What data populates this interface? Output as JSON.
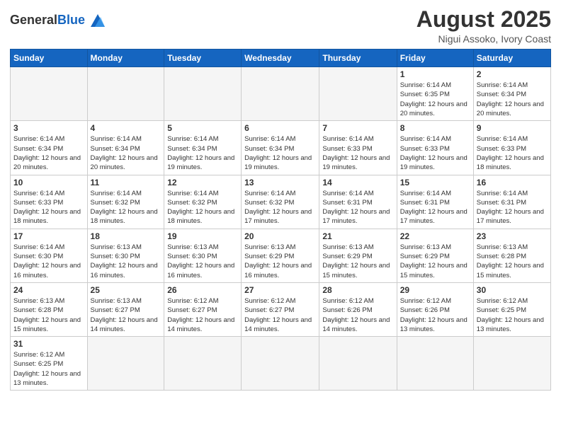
{
  "header": {
    "logo_general": "General",
    "logo_blue": "Blue",
    "month_title": "August 2025",
    "subtitle": "Nigui Assoko, Ivory Coast"
  },
  "weekdays": [
    "Sunday",
    "Monday",
    "Tuesday",
    "Wednesday",
    "Thursday",
    "Friday",
    "Saturday"
  ],
  "weeks": [
    [
      {
        "day": "",
        "info": ""
      },
      {
        "day": "",
        "info": ""
      },
      {
        "day": "",
        "info": ""
      },
      {
        "day": "",
        "info": ""
      },
      {
        "day": "",
        "info": ""
      },
      {
        "day": "1",
        "info": "Sunrise: 6:14 AM\nSunset: 6:35 PM\nDaylight: 12 hours\nand 20 minutes."
      },
      {
        "day": "2",
        "info": "Sunrise: 6:14 AM\nSunset: 6:34 PM\nDaylight: 12 hours\nand 20 minutes."
      }
    ],
    [
      {
        "day": "3",
        "info": "Sunrise: 6:14 AM\nSunset: 6:34 PM\nDaylight: 12 hours\nand 20 minutes."
      },
      {
        "day": "4",
        "info": "Sunrise: 6:14 AM\nSunset: 6:34 PM\nDaylight: 12 hours\nand 20 minutes."
      },
      {
        "day": "5",
        "info": "Sunrise: 6:14 AM\nSunset: 6:34 PM\nDaylight: 12 hours\nand 19 minutes."
      },
      {
        "day": "6",
        "info": "Sunrise: 6:14 AM\nSunset: 6:34 PM\nDaylight: 12 hours\nand 19 minutes."
      },
      {
        "day": "7",
        "info": "Sunrise: 6:14 AM\nSunset: 6:33 PM\nDaylight: 12 hours\nand 19 minutes."
      },
      {
        "day": "8",
        "info": "Sunrise: 6:14 AM\nSunset: 6:33 PM\nDaylight: 12 hours\nand 19 minutes."
      },
      {
        "day": "9",
        "info": "Sunrise: 6:14 AM\nSunset: 6:33 PM\nDaylight: 12 hours\nand 18 minutes."
      }
    ],
    [
      {
        "day": "10",
        "info": "Sunrise: 6:14 AM\nSunset: 6:33 PM\nDaylight: 12 hours\nand 18 minutes."
      },
      {
        "day": "11",
        "info": "Sunrise: 6:14 AM\nSunset: 6:32 PM\nDaylight: 12 hours\nand 18 minutes."
      },
      {
        "day": "12",
        "info": "Sunrise: 6:14 AM\nSunset: 6:32 PM\nDaylight: 12 hours\nand 18 minutes."
      },
      {
        "day": "13",
        "info": "Sunrise: 6:14 AM\nSunset: 6:32 PM\nDaylight: 12 hours\nand 17 minutes."
      },
      {
        "day": "14",
        "info": "Sunrise: 6:14 AM\nSunset: 6:31 PM\nDaylight: 12 hours\nand 17 minutes."
      },
      {
        "day": "15",
        "info": "Sunrise: 6:14 AM\nSunset: 6:31 PM\nDaylight: 12 hours\nand 17 minutes."
      },
      {
        "day": "16",
        "info": "Sunrise: 6:14 AM\nSunset: 6:31 PM\nDaylight: 12 hours\nand 17 minutes."
      }
    ],
    [
      {
        "day": "17",
        "info": "Sunrise: 6:14 AM\nSunset: 6:30 PM\nDaylight: 12 hours\nand 16 minutes."
      },
      {
        "day": "18",
        "info": "Sunrise: 6:13 AM\nSunset: 6:30 PM\nDaylight: 12 hours\nand 16 minutes."
      },
      {
        "day": "19",
        "info": "Sunrise: 6:13 AM\nSunset: 6:30 PM\nDaylight: 12 hours\nand 16 minutes."
      },
      {
        "day": "20",
        "info": "Sunrise: 6:13 AM\nSunset: 6:29 PM\nDaylight: 12 hours\nand 16 minutes."
      },
      {
        "day": "21",
        "info": "Sunrise: 6:13 AM\nSunset: 6:29 PM\nDaylight: 12 hours\nand 15 minutes."
      },
      {
        "day": "22",
        "info": "Sunrise: 6:13 AM\nSunset: 6:29 PM\nDaylight: 12 hours\nand 15 minutes."
      },
      {
        "day": "23",
        "info": "Sunrise: 6:13 AM\nSunset: 6:28 PM\nDaylight: 12 hours\nand 15 minutes."
      }
    ],
    [
      {
        "day": "24",
        "info": "Sunrise: 6:13 AM\nSunset: 6:28 PM\nDaylight: 12 hours\nand 15 minutes."
      },
      {
        "day": "25",
        "info": "Sunrise: 6:13 AM\nSunset: 6:27 PM\nDaylight: 12 hours\nand 14 minutes."
      },
      {
        "day": "26",
        "info": "Sunrise: 6:12 AM\nSunset: 6:27 PM\nDaylight: 12 hours\nand 14 minutes."
      },
      {
        "day": "27",
        "info": "Sunrise: 6:12 AM\nSunset: 6:27 PM\nDaylight: 12 hours\nand 14 minutes."
      },
      {
        "day": "28",
        "info": "Sunrise: 6:12 AM\nSunset: 6:26 PM\nDaylight: 12 hours\nand 14 minutes."
      },
      {
        "day": "29",
        "info": "Sunrise: 6:12 AM\nSunset: 6:26 PM\nDaylight: 12 hours\nand 13 minutes."
      },
      {
        "day": "30",
        "info": "Sunrise: 6:12 AM\nSunset: 6:25 PM\nDaylight: 12 hours\nand 13 minutes."
      }
    ],
    [
      {
        "day": "31",
        "info": "Sunrise: 6:12 AM\nSunset: 6:25 PM\nDaylight: 12 hours\nand 13 minutes."
      },
      {
        "day": "",
        "info": ""
      },
      {
        "day": "",
        "info": ""
      },
      {
        "day": "",
        "info": ""
      },
      {
        "day": "",
        "info": ""
      },
      {
        "day": "",
        "info": ""
      },
      {
        "day": "",
        "info": ""
      }
    ]
  ]
}
